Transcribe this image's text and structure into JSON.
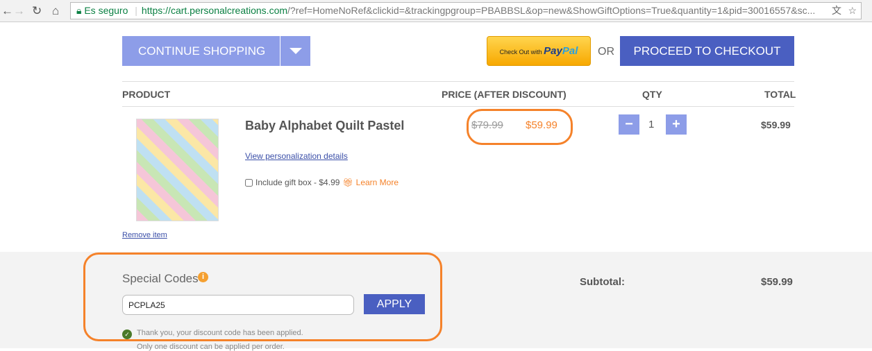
{
  "browser": {
    "secure_label": "Es seguro",
    "url_host": "https://cart.personalcreations.com",
    "url_rest": "/?ref=HomeNoRef&clickid=&trackingpgroup=PBABBSL&op=new&ShowGiftOptions=True&quantity=1&pid=30016557&sc..."
  },
  "actions": {
    "continue_shopping": "CONTINUE SHOPPING",
    "paypal_prefix": "Check Out with",
    "paypal_brand_a": "Pay",
    "paypal_brand_b": "Pal",
    "or": "OR",
    "proceed": "PROCEED TO CHECKOUT"
  },
  "table": {
    "headers": {
      "product": "PRODUCT",
      "price": "PRICE (AFTER DISCOUNT)",
      "qty": "QTY",
      "total": "TOTAL"
    }
  },
  "item": {
    "name": "Baby Alphabet Quilt Pastel",
    "personalization_link": "View personalization details",
    "gift_box": "Include gift box - $4.99",
    "learn_more": "Learn More",
    "remove": "Remove item",
    "original_price": "$79.99",
    "price": "$59.99",
    "qty": "1",
    "minus": "−",
    "plus": "+",
    "total": "$59.99",
    "gift_checked": false
  },
  "codes": {
    "title": "Special Codes",
    "value": "PCPLA25",
    "apply": "APPLY",
    "success": "Thank you, your discount code has been applied.",
    "note": "Only one discount can be applied per order."
  },
  "summary": {
    "subtotal_label": "Subtotal:",
    "subtotal": "$59.99"
  },
  "colors": {
    "accent": "#4a5fc1",
    "light_accent": "#8d9de8",
    "orange": "#f5822a",
    "highlight": "#f5822a"
  }
}
